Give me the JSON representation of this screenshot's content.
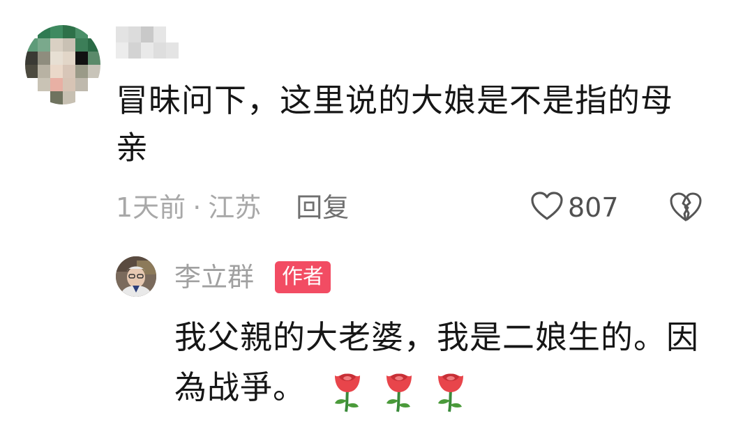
{
  "comment": {
    "text": "冒昧问下，这里说的大娘是不是指的母亲",
    "time": "1天前",
    "separator": "·",
    "location": "江苏",
    "reply_label": "回复",
    "like_count": "807",
    "icons": [
      "heart-outline-icon",
      "broken-heart-icon"
    ]
  },
  "reply": {
    "author_name": "李立群",
    "author_badge": "作者",
    "text": "我父親的大老婆，我是二娘生的。因為战爭。",
    "emoji": [
      "rose",
      "rose",
      "rose"
    ]
  },
  "colors": {
    "badge": "#f24c63",
    "text": "#161616",
    "meta": "#a8a8a8"
  }
}
